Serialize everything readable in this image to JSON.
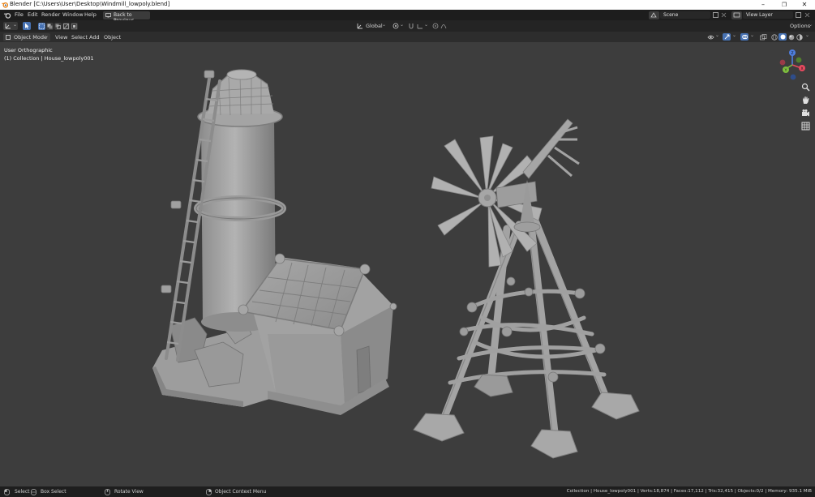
{
  "window": {
    "title": "Blender [C:\\Users\\User\\Desktop\\Windmill_lowpoly.blend]",
    "controls": [
      "–",
      "❐",
      "✕"
    ]
  },
  "menubar": {
    "items": [
      "File",
      "Edit",
      "Render",
      "Window",
      "Help"
    ],
    "back_button": "Back to Previous",
    "scene_label": "Scene",
    "view_layer_label": "View Layer"
  },
  "toolheader": {
    "transform_orientation": "Global",
    "options_label": "Options"
  },
  "header": {
    "mode": "Object Mode",
    "menus": [
      "View",
      "Select",
      "Add",
      "Object"
    ]
  },
  "viewport": {
    "view_name": "User Orthographic",
    "collection_info": "(1) Collection | House_lowpoly001",
    "gizmo_axes": {
      "x": "X",
      "y": "Y",
      "z": "Z"
    },
    "colors": {
      "x": "#e84a5f",
      "y": "#7fbf3f",
      "z": "#4f7fe0",
      "model": "#a9a9a9"
    }
  },
  "statusbar": {
    "select": "Select",
    "box_select": "Box Select",
    "rotate_view": "Rotate View",
    "context_menu": "Object Context Menu",
    "stats": "Collection | House_lowpoly001 | Verts:18,874 | Faces:17,112 | Tris:32,415 | Objects:0/2 | Memory: 935.1 MiB"
  }
}
